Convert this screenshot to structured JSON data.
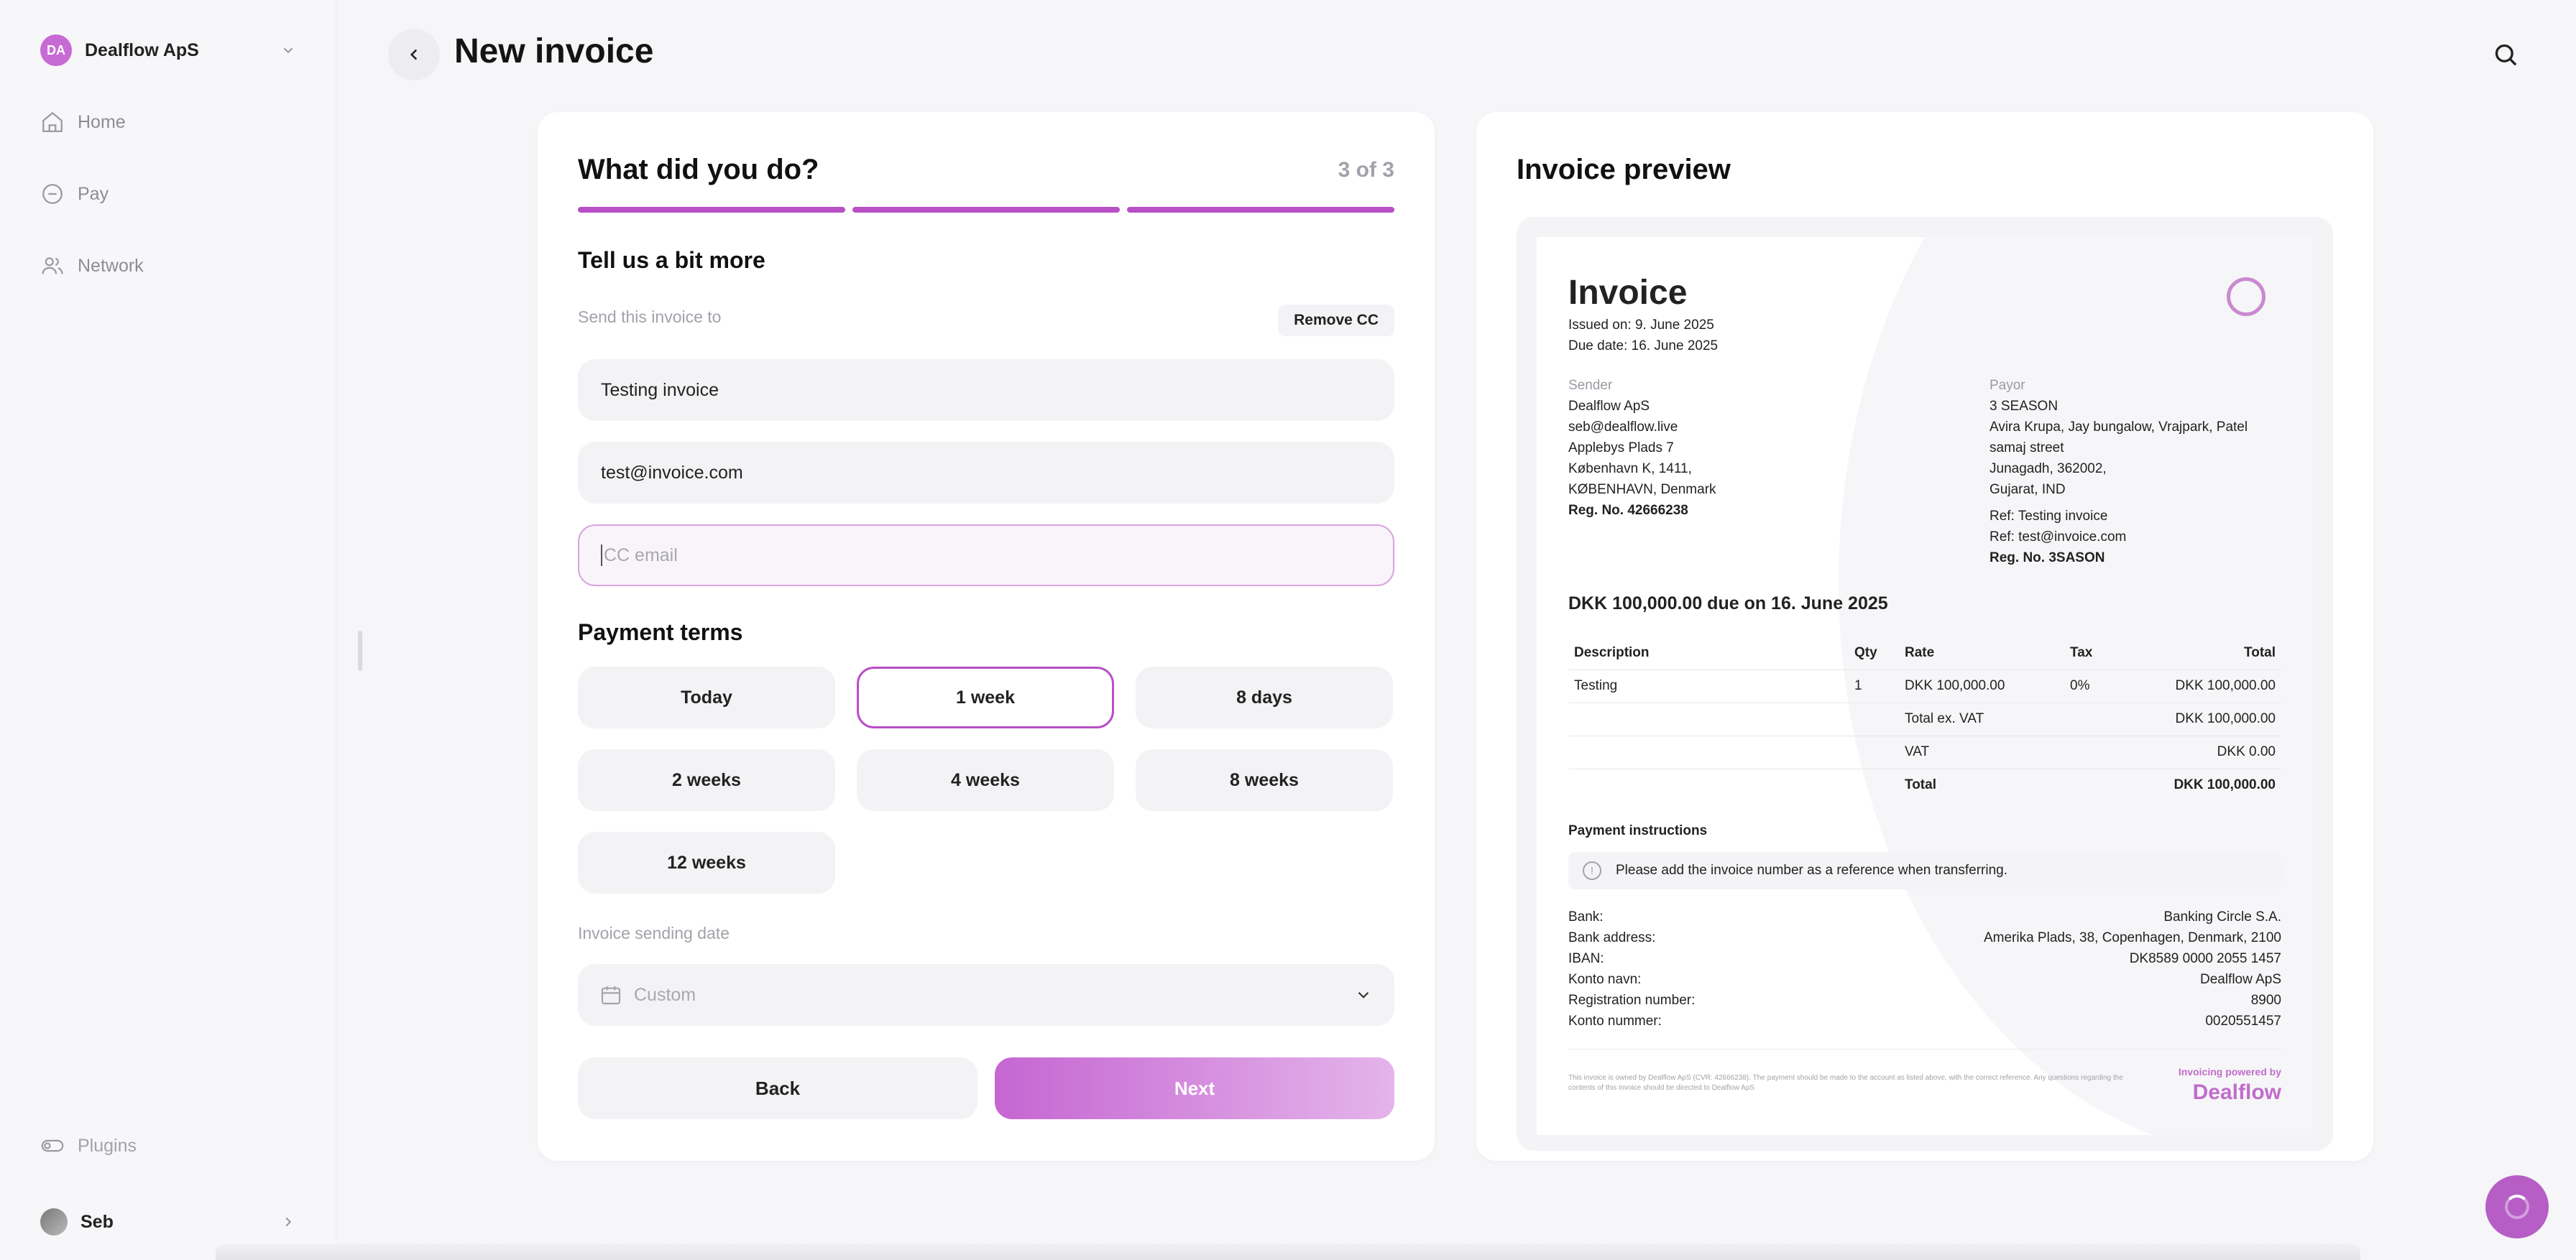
{
  "sidebar": {
    "org": {
      "initials": "DA",
      "name": "Dealflow ApS"
    },
    "items": [
      {
        "label": "Home"
      },
      {
        "label": "Pay"
      },
      {
        "label": "Network"
      }
    ],
    "plugins_label": "Plugins",
    "user_name": "Seb"
  },
  "header": {
    "title": "New invoice"
  },
  "form": {
    "title": "What did you do?",
    "step": "3 of 3",
    "subtitle": "Tell us a bit more",
    "send_to_label": "Send this invoice to",
    "remove_cc_label": "Remove CC",
    "name_value": "Testing invoice",
    "email_value": "test@invoice.com",
    "cc_placeholder": "CC email",
    "payment_terms_title": "Payment terms",
    "terms": [
      {
        "label": "Today",
        "selected": false
      },
      {
        "label": "1 week",
        "selected": true
      },
      {
        "label": "8 days",
        "selected": false
      },
      {
        "label": "2 weeks",
        "selected": false
      },
      {
        "label": "4 weeks",
        "selected": false
      },
      {
        "label": "8 weeks",
        "selected": false
      },
      {
        "label": "12 weeks",
        "selected": false
      }
    ],
    "sending_date_label": "Invoice sending date",
    "sending_date_value": "Custom",
    "back_label": "Back",
    "next_label": "Next"
  },
  "preview": {
    "title": "Invoice preview",
    "invoice": {
      "heading": "Invoice",
      "issued": "Issued on: 9. June 2025",
      "due": "Due date: 16. June 2025",
      "sender_label": "Sender",
      "sender_lines": [
        "Dealflow ApS",
        "seb@dealflow.live",
        "Applebys Plads 7",
        "København K, 1411,",
        "KØBENHAVN, Denmark"
      ],
      "sender_reg": "Reg. No. 42666238",
      "payor_label": "Payor",
      "payor_lines": [
        "3 SEASON",
        "Avira Krupa, Jay bungalow, Vrajpark, Patel",
        "samaj street",
        "Junagadh, 362002,",
        "Gujarat, IND"
      ],
      "payor_refs": [
        "Ref: Testing invoice",
        "Ref: test@invoice.com"
      ],
      "payor_reg": "Reg. No. 3SASON",
      "amount_due": "DKK 100,000.00 due on 16. June 2025",
      "columns": {
        "description": "Description",
        "qty": "Qty",
        "rate": "Rate",
        "tax": "Tax",
        "total": "Total"
      },
      "line": {
        "description": "Testing",
        "qty": "1",
        "rate": "DKK 100,000.00",
        "tax": "0%",
        "total": "DKK 100,000.00"
      },
      "totals": [
        {
          "label": "Total ex. VAT",
          "value": "DKK 100,000.00"
        },
        {
          "label": "VAT",
          "value": "DKK 0.00"
        },
        {
          "label": "Total",
          "value": "DKK 100,000.00"
        }
      ],
      "payment_title": "Payment instructions",
      "notice": "Please add the invoice number as a reference when transferring.",
      "bank": [
        {
          "label": "Bank:",
          "value": "Banking Circle S.A."
        },
        {
          "label": "Bank address:",
          "value": "Amerika Plads, 38, Copenhagen, Denmark, 2100"
        },
        {
          "label": "IBAN:",
          "value": "DK8589 0000 2055 1457"
        },
        {
          "label": "Konto navn:",
          "value": "Dealflow ApS"
        },
        {
          "label": "Registration number:",
          "value": "8900"
        },
        {
          "label": "Konto nummer:",
          "value": "0020551457"
        }
      ],
      "footer_text": "This invoice is owned by Dealflow ApS (CVR: 42666238). The payment should be made to the account as listed above, with the correct reference. Any questions regarding the contents of this invoice should be directed to Dealflow ApS",
      "powered_by": "Invoicing powered by",
      "brand": "Dealflow"
    }
  },
  "colors": {
    "accent": "#b84fc6",
    "background": "#f6f6f8"
  }
}
